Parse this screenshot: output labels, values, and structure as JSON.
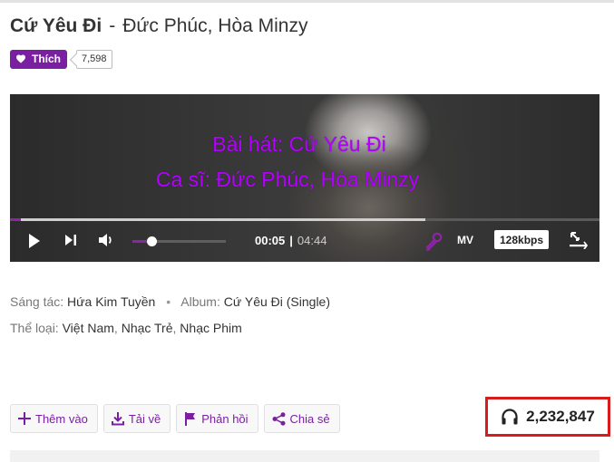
{
  "song": {
    "title": "Cứ Yêu Đi",
    "separator": "-",
    "artists": "Đức Phúc, Hòa Minzy"
  },
  "like": {
    "label": "Thích",
    "count": "7,598",
    "icon": "heart-icon"
  },
  "player": {
    "lyric_line_1": "Bài hát: Cứ Yêu Đi",
    "lyric_line_2": "Ca sĩ: Đức Phúc, Hòa Minzy",
    "current_time": "00:05",
    "time_separator": "|",
    "duration": "04:44",
    "progress_fraction": 0.018,
    "buffered_fraction": 0.705,
    "volume_fraction": 0.2,
    "mv_label": "MV",
    "quality_label": "128kbps",
    "lyric_color": "#b400ff",
    "accent_color": "#8e24aa",
    "icons": [
      "play-icon",
      "next-track-icon",
      "volume-icon",
      "karaoke-mic-icon",
      "expand-icon"
    ]
  },
  "meta": {
    "composer_label": "Sáng tác:",
    "composer": "Hứa Kim Tuyền",
    "album_label": "Album:",
    "album": "Cứ Yêu Đi (Single)",
    "genre_label": "Thể loại:",
    "genres": [
      "Việt Nam",
      "Nhạc Trẻ",
      "Nhạc Phim"
    ]
  },
  "actions": [
    {
      "label": "Thêm vào",
      "icon": "plus-icon"
    },
    {
      "label": "Tải về",
      "icon": "download-icon"
    },
    {
      "label": "Phản hồi",
      "icon": "flag-icon"
    },
    {
      "label": "Chia sẻ",
      "icon": "share-icon"
    }
  ],
  "listens": {
    "count": "2,232,847",
    "icon": "headphones-icon",
    "highlight_color": "#d71c1c"
  },
  "colors": {
    "brand_purple": "#7b1fa2"
  }
}
